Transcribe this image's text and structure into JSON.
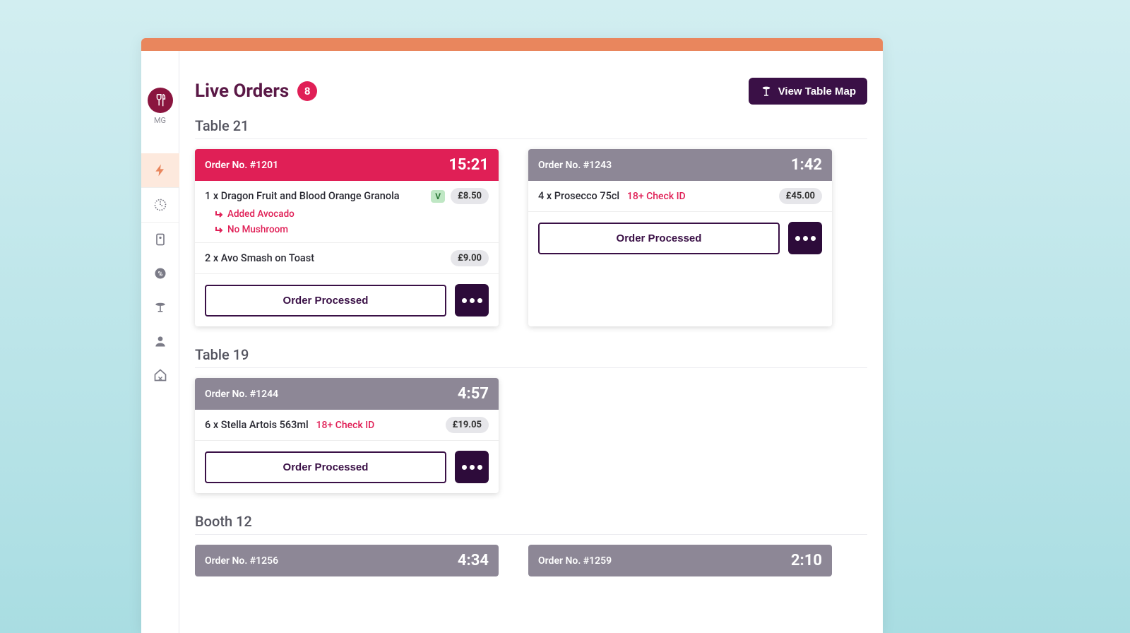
{
  "brand": {
    "initials": "MG"
  },
  "nav": {
    "live": "Live Orders",
    "history": "Order History",
    "menu": "Menu",
    "discounts": "Discounts",
    "tables": "Tables",
    "staff": "Staff",
    "venue": "Venue"
  },
  "header": {
    "title": "Live Orders",
    "count": "8",
    "view_map": "View Table Map"
  },
  "labels": {
    "order_no_prefix": "Order No. ",
    "processed": "Order Processed"
  },
  "sections": {
    "table21": {
      "title": "Table 21"
    },
    "table19": {
      "title": "Table 19"
    },
    "booth12": {
      "title": "Booth 12"
    }
  },
  "orders": {
    "o1201": {
      "number": "#1201",
      "time": "15:21",
      "items": [
        {
          "name": "1 x Dragon Fruit and Blood Orange Granola",
          "veg": "V",
          "price": "£8.50",
          "mods": [
            "Added Avocado",
            "No Mushroom"
          ]
        },
        {
          "name": "2 x Avo Smash on Toast",
          "price": "£9.00"
        }
      ]
    },
    "o1243": {
      "number": "#1243",
      "time": "1:42",
      "items": [
        {
          "name": "4 x Prosecco 75cl",
          "warn": "18+ Check ID",
          "price": "£45.00"
        }
      ]
    },
    "o1244": {
      "number": "#1244",
      "time": "4:57",
      "items": [
        {
          "name": "6 x Stella Artois 563ml",
          "warn": "18+ Check ID",
          "price": "£19.05"
        }
      ]
    },
    "o1256": {
      "number": "#1256",
      "time": "4:34"
    },
    "o1259": {
      "number": "#1259",
      "time": "2:10"
    }
  }
}
